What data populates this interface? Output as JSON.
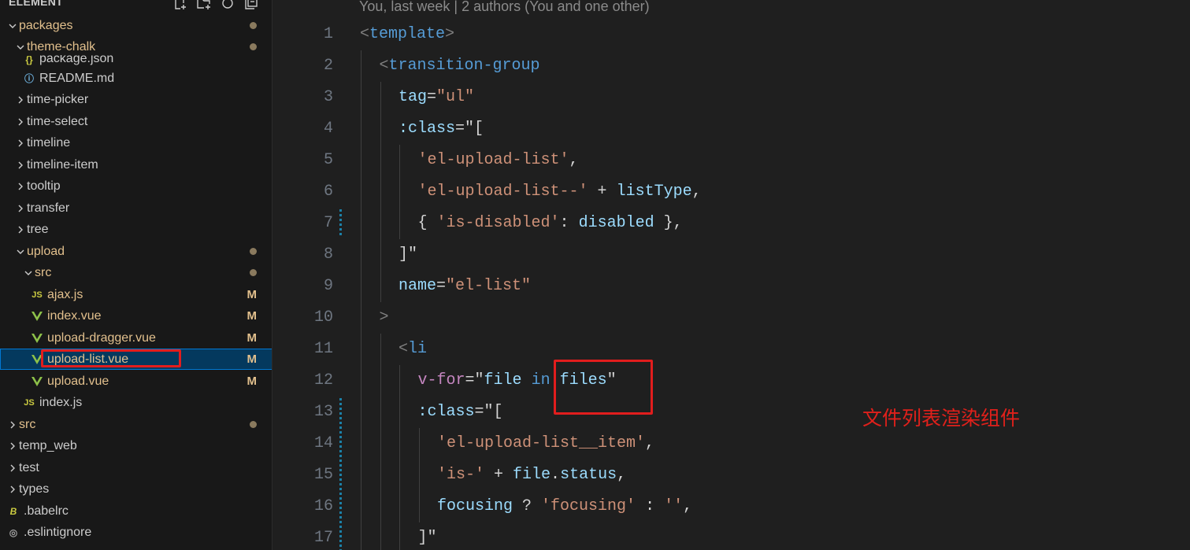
{
  "explorer": {
    "title": "ELEMENT",
    "items": [
      {
        "label": "packages",
        "depth": 0,
        "kind": "folder-open",
        "dot": true
      },
      {
        "label": "theme-chalk",
        "depth": 1,
        "kind": "folder-open",
        "dot": true
      },
      {
        "label": "package.json",
        "depth": 2,
        "kind": "file-json"
      },
      {
        "label": "README.md",
        "depth": 2,
        "kind": "file-info"
      },
      {
        "label": "time-picker",
        "depth": 1,
        "kind": "folder"
      },
      {
        "label": "time-select",
        "depth": 1,
        "kind": "folder"
      },
      {
        "label": "timeline",
        "depth": 1,
        "kind": "folder"
      },
      {
        "label": "timeline-item",
        "depth": 1,
        "kind": "folder"
      },
      {
        "label": "tooltip",
        "depth": 1,
        "kind": "folder"
      },
      {
        "label": "transfer",
        "depth": 1,
        "kind": "folder"
      },
      {
        "label": "tree",
        "depth": 1,
        "kind": "folder"
      },
      {
        "label": "upload",
        "depth": 1,
        "kind": "folder-open",
        "dot": true
      },
      {
        "label": "src",
        "depth": 2,
        "kind": "folder-open",
        "dot": true
      },
      {
        "label": "ajax.js",
        "depth": 3,
        "kind": "js",
        "badge": "M"
      },
      {
        "label": "index.vue",
        "depth": 3,
        "kind": "vue",
        "badge": "M"
      },
      {
        "label": "upload-dragger.vue",
        "depth": 3,
        "kind": "vue",
        "badge": "M"
      },
      {
        "label": "upload-list.vue",
        "depth": 3,
        "kind": "vue",
        "badge": "M",
        "selected": true
      },
      {
        "label": "upload.vue",
        "depth": 3,
        "kind": "vue",
        "badge": "M"
      },
      {
        "label": "index.js",
        "depth": 2,
        "kind": "js"
      },
      {
        "label": "src",
        "depth": 0,
        "kind": "folder",
        "dot": true
      },
      {
        "label": "temp_web",
        "depth": 0,
        "kind": "folder"
      },
      {
        "label": "test",
        "depth": 0,
        "kind": "folder"
      },
      {
        "label": "types",
        "depth": 0,
        "kind": "folder"
      },
      {
        "label": ".babelrc",
        "depth": 0,
        "kind": "babel"
      },
      {
        "label": ".eslintignore",
        "depth": 0,
        "kind": "eslint"
      }
    ],
    "badge_modified": "M"
  },
  "editor": {
    "blame": "You, last week | 2 authors (You and one other)",
    "lines": [
      {
        "n": "1",
        "tokens": [
          [
            "t-punc",
            "<"
          ],
          [
            "t-tag",
            "template"
          ],
          [
            "t-punc",
            ">"
          ]
        ]
      },
      {
        "n": "2",
        "tokens": [
          [
            "t-punc",
            "<"
          ],
          [
            "t-tag",
            "transition-group"
          ]
        ]
      },
      {
        "n": "3",
        "tokens": [
          [
            "t-attr",
            "tag"
          ],
          [
            "t-plain",
            "="
          ],
          [
            "t-str",
            "\"ul\""
          ]
        ]
      },
      {
        "n": "4",
        "tokens": [
          [
            "t-attr",
            ":class"
          ],
          [
            "t-plain",
            "=\"["
          ]
        ]
      },
      {
        "n": "5",
        "tokens": [
          [
            "t-str",
            "'el-upload-list'"
          ],
          [
            "t-plain",
            ","
          ]
        ]
      },
      {
        "n": "6",
        "tokens": [
          [
            "t-str",
            "'el-upload-list--'"
          ],
          [
            "t-plain",
            " + "
          ],
          [
            "t-attr",
            "listType"
          ],
          [
            "t-plain",
            ","
          ]
        ]
      },
      {
        "n": "7",
        "tokens": [
          [
            "t-plain",
            "{ "
          ],
          [
            "t-str",
            "'is-disabled'"
          ],
          [
            "t-plain",
            ": "
          ],
          [
            "t-attr",
            "disabled"
          ],
          [
            "t-plain",
            " },"
          ]
        ]
      },
      {
        "n": "8",
        "tokens": [
          [
            "t-plain",
            "]\""
          ]
        ]
      },
      {
        "n": "9",
        "tokens": [
          [
            "t-attr",
            "name"
          ],
          [
            "t-plain",
            "="
          ],
          [
            "t-str",
            "\"el-list\""
          ]
        ]
      },
      {
        "n": "10",
        "tokens": [
          [
            "t-punc",
            ">"
          ]
        ]
      },
      {
        "n": "11",
        "tokens": [
          [
            "t-punc",
            "<"
          ],
          [
            "t-tag",
            "li"
          ]
        ]
      },
      {
        "n": "12",
        "tokens": [
          [
            "t-dir",
            "v-for"
          ],
          [
            "t-plain",
            "=\""
          ],
          [
            "t-attr",
            "file"
          ],
          [
            "t-plain",
            " "
          ],
          [
            "t-kw",
            "in"
          ],
          [
            "t-plain",
            " "
          ],
          [
            "t-attr",
            "files"
          ],
          [
            "t-plain",
            "\""
          ]
        ]
      },
      {
        "n": "13",
        "tokens": [
          [
            "t-attr",
            ":class"
          ],
          [
            "t-plain",
            "=\"["
          ]
        ]
      },
      {
        "n": "14",
        "tokens": [
          [
            "t-str",
            "'el-upload-list__item'"
          ],
          [
            "t-plain",
            ","
          ]
        ]
      },
      {
        "n": "15",
        "tokens": [
          [
            "t-str",
            "'is-'"
          ],
          [
            "t-plain",
            " + "
          ],
          [
            "t-attr",
            "file"
          ],
          [
            "t-plain",
            "."
          ],
          [
            "t-attr",
            "status"
          ],
          [
            "t-plain",
            ","
          ]
        ]
      },
      {
        "n": "16",
        "tokens": [
          [
            "t-attr",
            "focusing"
          ],
          [
            "t-plain",
            " ? "
          ],
          [
            "t-str",
            "'focusing'"
          ],
          [
            "t-plain",
            " : "
          ],
          [
            "t-str",
            "''"
          ],
          [
            "t-plain",
            ","
          ]
        ]
      },
      {
        "n": "17",
        "tokens": [
          [
            "t-plain",
            "]\""
          ]
        ]
      }
    ]
  },
  "annotation": "文件列表渲染组件",
  "colors": {
    "highlight_box": "#e11d1d",
    "annotation_text": "#e0201b",
    "selection_bg": "#04395e"
  }
}
